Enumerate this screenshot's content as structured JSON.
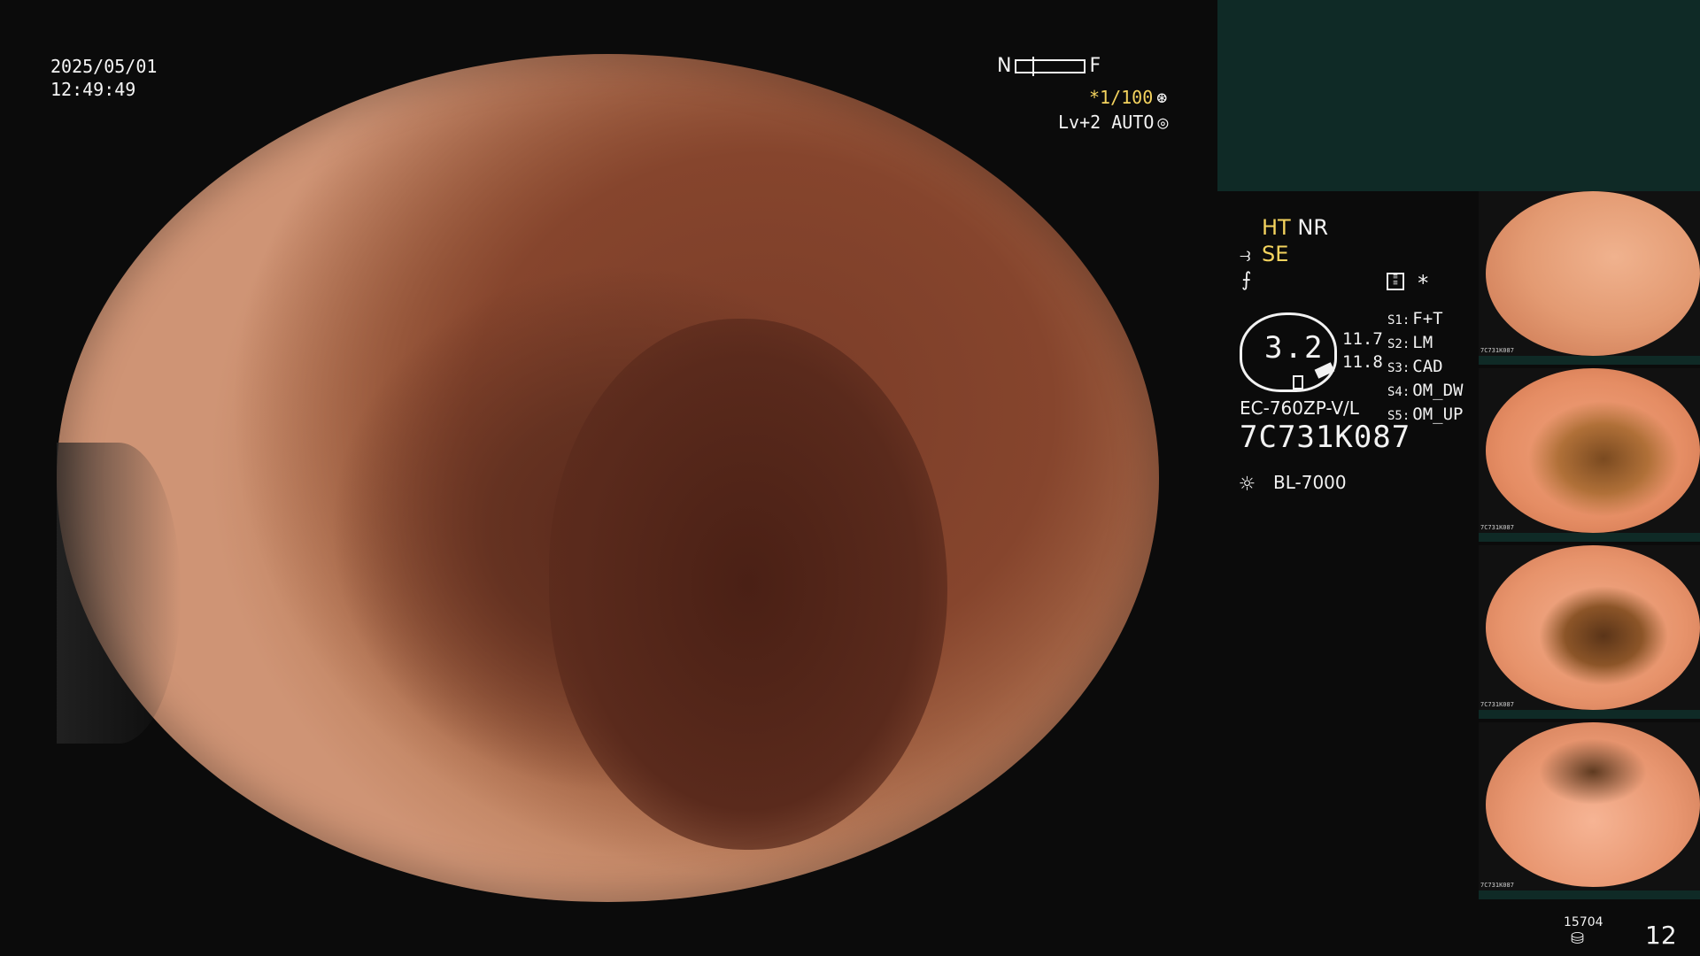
{
  "overlay": {
    "date": "2025/05/01",
    "time": "12:49:49",
    "near_label": "N",
    "far_label": "F",
    "shutter": "*1/100",
    "shutter_icon": "aperture-icon",
    "level": "Lv+2 AUTO",
    "level_icon": "iris-icon"
  },
  "panel": {
    "mode_ht": "HT",
    "mode_nr": "NR",
    "mode_se": "SE",
    "se_icon_glyph": "⥽",
    "f_icon_glyph": "⨍",
    "gauge_value": "3.2",
    "gauge_top": "11.7",
    "gauge_bottom": "11.8",
    "star": "*",
    "switches": [
      {
        "key": "S1:",
        "value": "F+T"
      },
      {
        "key": "S2:",
        "value": "LM"
      },
      {
        "key": "S3:",
        "value": "CAD"
      },
      {
        "key": "S4:",
        "value": "OM_DW"
      },
      {
        "key": "S5:",
        "value": "OM_UP"
      }
    ],
    "scope_model": "EC-760ZP-V/L",
    "scope_serial": "7C731K087",
    "light_source": "BL-7000",
    "light_icon_glyph": "☼"
  },
  "thumbs": [
    {
      "serial": "7C731K087"
    },
    {
      "serial": "7C731K087"
    },
    {
      "serial": "7C731K087"
    },
    {
      "serial": "7C731K087"
    }
  ],
  "footer": {
    "count_small": "15704",
    "count_icon_glyph": "⛁",
    "count": "12"
  }
}
